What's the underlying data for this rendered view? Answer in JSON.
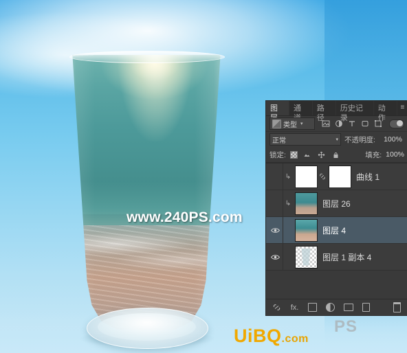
{
  "canvas": {
    "watermark_main": "www.240PS.com",
    "watermark_ps": "PS",
    "watermark_site": "UiBQ",
    "watermark_site_sub": ".com",
    "image_description": "underwater-sea-in-glass"
  },
  "panel": {
    "tabs": [
      {
        "label": "图层",
        "active": true
      },
      {
        "label": "通道",
        "active": false
      },
      {
        "label": "路径",
        "active": false
      },
      {
        "label": "历史记录",
        "active": false
      },
      {
        "label": "动作",
        "active": false
      }
    ],
    "menu_icon": "panel-menu-icon",
    "filter": {
      "kind_label": "类型",
      "kind_icon": "layer-kind-icon",
      "caret": "▾",
      "icons": [
        "pixel-filter-icon",
        "adjustment-filter-icon",
        "type-filter-icon",
        "shape-filter-icon",
        "smart-object-filter-icon"
      ],
      "toggle": "filter-enable-toggle"
    },
    "blend": {
      "mode": "正常",
      "caret": "▾",
      "opacity_label": "不透明度:",
      "opacity_value": "100%"
    },
    "lock": {
      "label": "锁定:",
      "icons": [
        "lock-transparent-icon",
        "lock-image-icon",
        "lock-position-icon",
        "lock-all-icon"
      ],
      "fill_label": "填充:",
      "fill_value": "100%"
    },
    "layers": [
      {
        "name": "曲线 1",
        "visible": false,
        "selected": false,
        "thumb": "curves",
        "has_mask": true,
        "linked": true,
        "clipped": true
      },
      {
        "name": "图层 26",
        "visible": false,
        "selected": false,
        "thumb": "sea1",
        "has_mask": false,
        "linked": false,
        "clipped": true
      },
      {
        "name": "图层 4",
        "visible": true,
        "selected": true,
        "thumb": "sea2",
        "has_mask": false,
        "linked": false,
        "clipped": false
      },
      {
        "name": "图层 1 副本 4",
        "visible": true,
        "selected": false,
        "thumb": "glass",
        "has_mask": false,
        "linked": false,
        "clipped": false
      }
    ],
    "bottom_tools": [
      "link-layers-icon",
      "layer-style-fx-icon",
      "add-mask-icon",
      "new-fill-adjustment-icon",
      "new-group-icon",
      "new-layer-icon",
      "delete-layer-icon"
    ],
    "fx_label": "fx."
  }
}
